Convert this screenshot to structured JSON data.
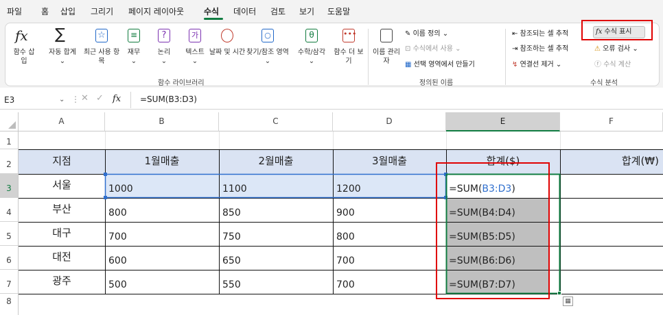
{
  "menu": [
    "파일",
    "홈",
    "삽입",
    "그리기",
    "페이지 레이아웃",
    "수식",
    "데이터",
    "검토",
    "보기",
    "도움말"
  ],
  "ribbon": {
    "func_library": {
      "insert": "함수 삽입",
      "autosum": "자동 합계",
      "recent": "최근 사용 항목",
      "finance": "재무",
      "logic": "논리",
      "text": "텍스트",
      "datetime": "날짜 및 시간",
      "lookup": "찾기/참조 영역",
      "math": "수학/삼각",
      "more": "함수 더 보기",
      "group": "함수 라이브러리"
    },
    "names": {
      "manager": "이름 관리자",
      "define": "이름 정의",
      "use_in_formula": "수식에서 사용",
      "create_from_sel": "선택 영역에서 만들기",
      "group": "정의된 이름"
    },
    "audit": {
      "trace_prec": "참조되는 셀 추적",
      "trace_dep": "참조하는 셀 추적",
      "remove_arrows": "연결선 제거",
      "show_formulas": "수식 표시",
      "error_check": "오류 검사",
      "evaluate": "수식 계산",
      "group": "수식 분석"
    }
  },
  "formula_bar": {
    "name_box": "E3",
    "fx": "fx",
    "formula": "=SUM(B3:D3)"
  },
  "columns": [
    "A",
    "B",
    "C",
    "D",
    "E",
    "F"
  ],
  "rows": [
    "1",
    "2",
    "3",
    "4",
    "5",
    "6",
    "7",
    "8"
  ],
  "table": {
    "headers": [
      "지점",
      "1월매출",
      "2월매출",
      "3월매출",
      "합계($)",
      "합계(₩)"
    ],
    "data": [
      {
        "branch": "서울",
        "m1": "1000",
        "m2": "1100",
        "m3": "1200"
      },
      {
        "branch": "부산",
        "m1": "800",
        "m2": "850",
        "m3": "900",
        "f": "=SUM(B4:D4)"
      },
      {
        "branch": "대구",
        "m1": "700",
        "m2": "750",
        "m3": "800",
        "f": "=SUM(B5:D5)"
      },
      {
        "branch": "대전",
        "m1": "600",
        "m2": "650",
        "m3": "700",
        "f": "=SUM(B6:D6)"
      },
      {
        "branch": "광주",
        "m1": "500",
        "m2": "550",
        "m3": "700",
        "f": "=SUM(B7:D7)"
      }
    ],
    "e3_prefix": "=SUM(",
    "e3_ref": "B3:D3",
    "e3_suffix": ")"
  },
  "colors": {
    "accent": "#107c41",
    "highlight": "#e00000",
    "header_fill": "#dae3f3",
    "ref_blue": "#2f6fce",
    "formula_fill": "#bfbfbf"
  }
}
